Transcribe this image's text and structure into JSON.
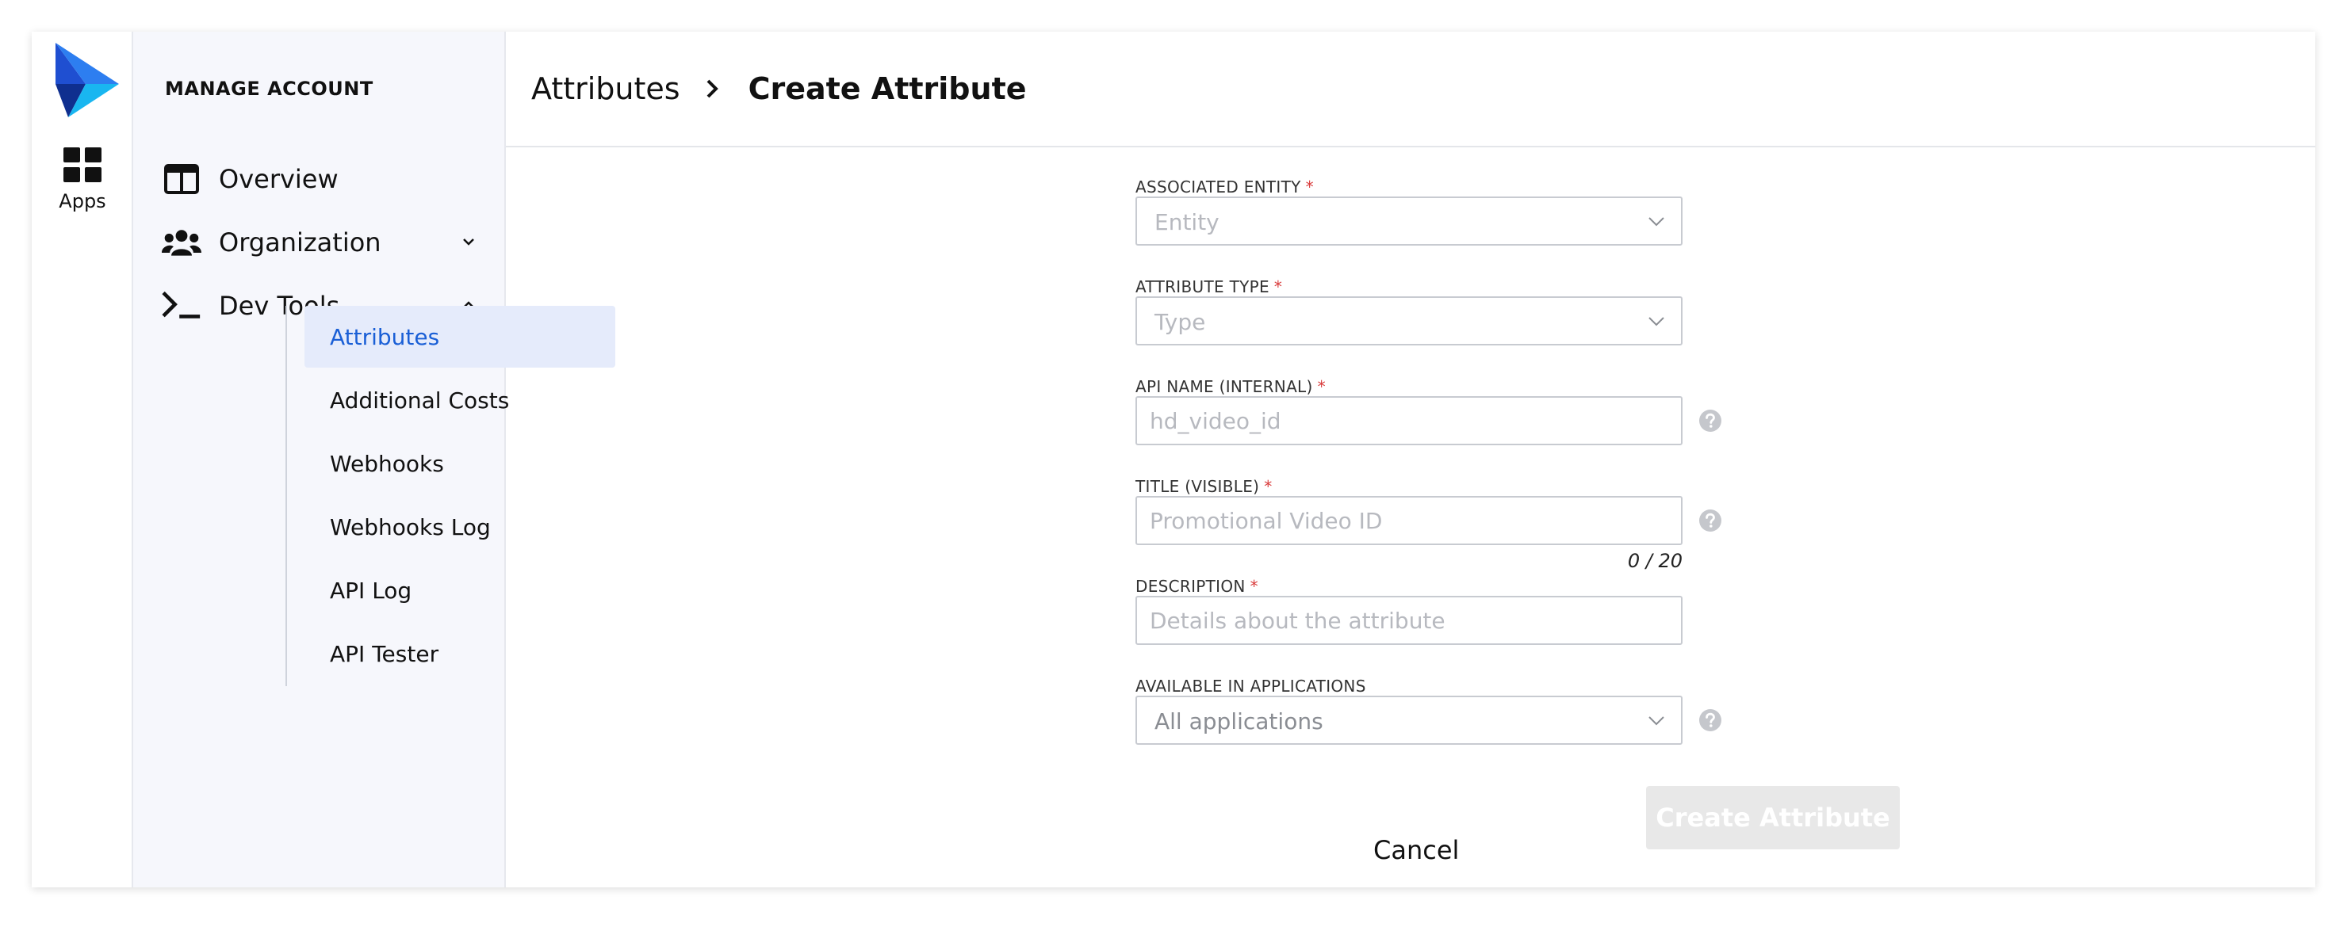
{
  "colors": {
    "accent": "#1a5fd6",
    "active_bg": "#e5ebfb",
    "sidebar_bg": "#f6f7fc",
    "required": "#d93b3b",
    "disabled_button": "#e8e8e8"
  },
  "rail": {
    "logo_icon": "brand-logo-icon",
    "apps_icon": "grid-icon",
    "apps_label": "Apps"
  },
  "sidebar": {
    "heading": "MANAGE ACCOUNT",
    "items": [
      {
        "label": "Overview",
        "icon": "layout-icon"
      },
      {
        "label": "Organization",
        "icon": "users-icon",
        "expanded": false
      },
      {
        "label": "Dev Tools",
        "icon": "terminal-icon",
        "expanded": true
      }
    ],
    "dev_tools_items": [
      {
        "label": "Attributes",
        "active": true
      },
      {
        "label": "Additional Costs",
        "active": false
      },
      {
        "label": "Webhooks",
        "active": false
      },
      {
        "label": "Webhooks Log",
        "active": false
      },
      {
        "label": "API Log",
        "active": false
      },
      {
        "label": "API Tester",
        "active": false
      }
    ]
  },
  "header": {
    "breadcrumb_parent": "Attributes",
    "breadcrumb_current": "Create Attribute"
  },
  "form": {
    "associated_entity": {
      "label": "ASSOCIATED ENTITY",
      "required_mark": "*",
      "placeholder": "Entity"
    },
    "attribute_type": {
      "label": "ATTRIBUTE TYPE",
      "required_mark": "*",
      "placeholder": "Type"
    },
    "api_name": {
      "label": "API NAME (INTERNAL)",
      "required_mark": "*",
      "placeholder": "hd_video_id",
      "value": ""
    },
    "title": {
      "label": "TITLE (VISIBLE)",
      "required_mark": "*",
      "placeholder": "Promotional Video ID",
      "value": "",
      "counter": "0 / 20"
    },
    "description": {
      "label": "DESCRIPTION",
      "required_mark": "*",
      "placeholder": "Details about the attribute",
      "value": ""
    },
    "available_in_applications": {
      "label": "AVAILABLE IN APPLICATIONS",
      "value": "All applications"
    }
  },
  "actions": {
    "cancel_label": "Cancel",
    "create_label": "Create Attribute"
  }
}
